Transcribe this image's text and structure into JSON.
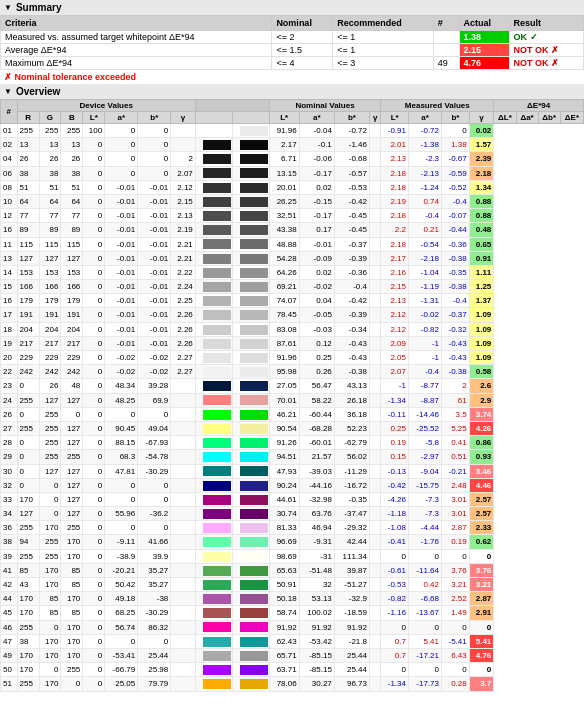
{
  "summary": {
    "title": "Summary",
    "columns": [
      "Criteria",
      "Nominal",
      "Recommended",
      "#",
      "Actual",
      "Result"
    ],
    "rows": [
      {
        "criteria": "Measured vs. assumed target whitepoint ΔE*94",
        "nominal": "<= 2",
        "recommended": "<= 1",
        "count": "",
        "actual": "1.38",
        "actual_color": "#00cc00",
        "result": "OK ✓",
        "result_class": "ok"
      },
      {
        "criteria": "Average ΔE*94",
        "nominal": "<= 1.5",
        "recommended": "<= 1",
        "count": "",
        "actual": "2.15",
        "actual_color": "#ff4444",
        "result": "NOT OK ✗",
        "result_class": "notok"
      },
      {
        "criteria": "Maximum ΔE*94",
        "nominal": "<= 4",
        "recommended": "<= 3",
        "count": "49",
        "actual": "4.76",
        "actual_color": "#ff0000",
        "result": "NOT OK ✗",
        "result_class": "notok"
      }
    ],
    "nominal_exceeded_label": "✗ Nominal tolerance exceeded"
  },
  "overview": {
    "title": "Overview",
    "col_headers": {
      "hash": "#",
      "device": "Device Values",
      "device_sub": [
        "#",
        "R",
        "G",
        "B",
        "L*",
        "a*",
        "b*",
        "γ"
      ],
      "nominal": "Nominal Values",
      "nominal_sub": [
        "L*",
        "a*",
        "b*",
        "γ"
      ],
      "measured": "Measured Values",
      "measured_sub": [
        "L*",
        "a*",
        "b*",
        "γ"
      ],
      "delta": "ΔE*94",
      "delta_sub": [
        "ΔL*",
        "Δa*",
        "Δb*",
        "ΔE*"
      ]
    },
    "rows": [
      {
        "n": "01",
        "r": 255,
        "g": 255,
        "b": 255,
        "L_nom": 100,
        "a_nom": 0,
        "b_nom": 0,
        "g_nom": null,
        "L_meas": 91.96,
        "a_meas": -0.04,
        "b_meas": -0.72,
        "g_meas": null,
        "dL": -0.91,
        "da": -0.72,
        "db": 0,
        "de": 0.02,
        "swatch": "#ffffff",
        "swatch_meas": "#e8e8e8"
      },
      {
        "n": "02",
        "r": 13,
        "g": 13,
        "b": 13,
        "L_nom": 0,
        "a_nom": 0,
        "b_nom": 0,
        "g_nom": null,
        "L_meas": 2.17,
        "a_meas": -0.1,
        "b_meas": -1.46,
        "g_meas": null,
        "dL": 2.01,
        "da": -1.38,
        "db": 1.38,
        "de": 1.57,
        "swatch": "#0d0d0d",
        "swatch_meas": "#080808"
      },
      {
        "n": "04",
        "r": 26,
        "g": 26,
        "b": 26,
        "L_nom": 0,
        "a_nom": 0,
        "b_nom": 0,
        "g_nom": 2,
        "L_meas": 6.71,
        "a_meas": -0.06,
        "b_meas": -0.68,
        "g_meas": null,
        "dL": 2.13,
        "da": -2.3,
        "db": -0.67,
        "de": 2.39,
        "swatch": "#1a1a1a",
        "swatch_meas": "#111111"
      },
      {
        "n": "06",
        "r": 38,
        "g": 38,
        "b": 38,
        "L_nom": 0,
        "a_nom": 0,
        "b_nom": 0,
        "g_nom": 2.07,
        "L_meas": 13.15,
        "a_meas": -0.17,
        "b_meas": -0.57,
        "g_meas": null,
        "dL": 2.18,
        "da": -2.13,
        "db": -0.59,
        "de": 2.18,
        "swatch": "#262626",
        "swatch_meas": "#1e1e1e"
      },
      {
        "n": "08",
        "r": 51,
        "g": 51,
        "b": 51,
        "L_nom": 0,
        "a_nom": -0.01,
        "b_nom": -0.01,
        "g_nom": 2.12,
        "L_meas": 20.01,
        "a_meas": 0.02,
        "b_meas": -0.53,
        "g_meas": null,
        "dL": 2.18,
        "da": -1.24,
        "db": -0.52,
        "de": 1.34,
        "swatch": "#333333",
        "swatch_meas": "#2e2e2e"
      },
      {
        "n": "10",
        "r": 64,
        "g": 64,
        "b": 64,
        "L_nom": 0,
        "a_nom": -0.01,
        "b_nom": -0.01,
        "g_nom": 2.15,
        "L_meas": 26.25,
        "a_meas": -0.15,
        "b_meas": -0.42,
        "g_meas": null,
        "dL": 2.19,
        "da": 0.74,
        "db": -0.4,
        "de": 0.88,
        "swatch": "#404040",
        "swatch_meas": "#3c3c3c"
      },
      {
        "n": "12",
        "r": 77,
        "g": 77,
        "b": 77,
        "L_nom": 0,
        "a_nom": -0.01,
        "b_nom": -0.01,
        "g_nom": 2.13,
        "L_meas": 32.51,
        "a_meas": -0.17,
        "b_meas": -0.45,
        "g_meas": null,
        "dL": 2.18,
        "da": -0.4,
        "db": -0.07,
        "de": 0.88,
        "swatch": "#4d4d4d",
        "swatch_meas": "#484848"
      },
      {
        "n": "16",
        "r": 89,
        "g": 89,
        "b": 89,
        "L_nom": 0,
        "a_nom": -0.01,
        "b_nom": -0.01,
        "g_nom": 2.19,
        "L_meas": 43.38,
        "a_meas": 0.17,
        "b_meas": -0.45,
        "g_meas": null,
        "dL": 2.2,
        "da": 0.21,
        "db": -0.44,
        "de": 0.48,
        "swatch": "#595959",
        "swatch_meas": "#555555"
      },
      {
        "n": "11",
        "r": 115,
        "g": 115,
        "b": 115,
        "L_nom": 0,
        "a_nom": -0.01,
        "b_nom": -0.01,
        "g_nom": 2.21,
        "L_meas": 48.88,
        "a_meas": -0.01,
        "b_meas": -0.37,
        "g_meas": null,
        "dL": 2.18,
        "da": -0.54,
        "db": -0.36,
        "de": 0.65,
        "swatch": "#737373",
        "swatch_meas": "#6e6e6e"
      },
      {
        "n": "13",
        "r": 127,
        "g": 127,
        "b": 127,
        "L_nom": 0,
        "a_nom": -0.01,
        "b_nom": -0.01,
        "g_nom": 2.21,
        "L_meas": 54.28,
        "a_meas": -0.09,
        "b_meas": -0.39,
        "g_meas": null,
        "dL": 2.17,
        "da": -2.18,
        "db": -0.38,
        "de": 0.91,
        "swatch": "#7f7f7f",
        "swatch_meas": "#7a7a7a"
      },
      {
        "n": "14",
        "r": 153,
        "g": 153,
        "b": 153,
        "L_nom": 0,
        "a_nom": -0.01,
        "b_nom": -0.01,
        "g_nom": 2.22,
        "L_meas": 64.26,
        "a_meas": 0.02,
        "b_meas": -0.36,
        "g_meas": null,
        "dL": 2.16,
        "da": -1.04,
        "db": -0.35,
        "de": 1.11,
        "swatch": "#999999",
        "swatch_meas": "#949494"
      },
      {
        "n": "15",
        "r": 166,
        "g": 166,
        "b": 166,
        "L_nom": 0,
        "a_nom": -0.01,
        "b_nom": -0.01,
        "g_nom": 2.24,
        "L_meas": 69.21,
        "a_meas": -0.02,
        "b_meas": -0.4,
        "g_meas": null,
        "dL": 2.15,
        "da": -1.19,
        "db": -0.38,
        "de": 1.25,
        "swatch": "#a6a6a6",
        "swatch_meas": "#a1a1a1"
      },
      {
        "n": "16",
        "r": 179,
        "g": 179,
        "b": 179,
        "L_nom": 0,
        "a_nom": -0.01,
        "b_nom": -0.01,
        "g_nom": 2.25,
        "L_meas": 74.07,
        "a_meas": 0.04,
        "b_meas": -0.42,
        "g_meas": null,
        "dL": 2.13,
        "da": -1.31,
        "db": -0.4,
        "de": 1.37,
        "swatch": "#b3b3b3",
        "swatch_meas": "#aeaeae"
      },
      {
        "n": "17",
        "r": 191,
        "g": 191,
        "b": 191,
        "L_nom": 0,
        "a_nom": -0.01,
        "b_nom": -0.01,
        "g_nom": 2.26,
        "L_meas": 78.45,
        "a_meas": -0.05,
        "b_meas": -0.39,
        "g_meas": null,
        "dL": 2.12,
        "da": -0.02,
        "db": -0.37,
        "de": 1.09,
        "swatch": "#bfbfbf",
        "swatch_meas": "#bababa"
      },
      {
        "n": "18",
        "r": 204,
        "g": 204,
        "b": 204,
        "L_nom": 0,
        "a_nom": -0.01,
        "b_nom": -0.01,
        "g_nom": 2.26,
        "L_meas": 83.08,
        "a_meas": -0.03,
        "b_meas": -0.34,
        "g_meas": null,
        "dL": 2.12,
        "da": -0.82,
        "db": -0.32,
        "de": 1.09,
        "swatch": "#cccccc",
        "swatch_meas": "#c7c7c7"
      },
      {
        "n": "19",
        "r": 217,
        "g": 217,
        "b": 217,
        "L_nom": 0,
        "a_nom": -0.01,
        "b_nom": -0.01,
        "g_nom": 2.26,
        "L_meas": 87.61,
        "a_meas": 0.12,
        "b_meas": -0.43,
        "g_meas": null,
        "dL": 2.09,
        "da": -1,
        "db": -0.43,
        "de": 1.09,
        "swatch": "#d9d9d9",
        "swatch_meas": "#d4d4d4"
      },
      {
        "n": "20",
        "r": 229,
        "g": 229,
        "b": 229,
        "L_nom": 0,
        "a_nom": -0.02,
        "b_nom": -0.02,
        "g_nom": 2.27,
        "L_meas": 91.96,
        "a_meas": 0.25,
        "b_meas": -0.43,
        "g_meas": null,
        "dL": 2.05,
        "da": -1,
        "db": -0.43,
        "de": 1.09,
        "swatch": "#e5e5e5",
        "swatch_meas": "#e0e0e0"
      },
      {
        "n": "22",
        "r": 242,
        "g": 242,
        "b": 242,
        "L_nom": 0,
        "a_nom": -0.02,
        "b_nom": -0.02,
        "g_nom": 2.27,
        "L_meas": 95.98,
        "a_meas": 0.26,
        "b_meas": -0.38,
        "g_meas": null,
        "dL": 2.07,
        "da": -0.4,
        "db": -0.38,
        "de": 0.58,
        "swatch": "#f2f2f2",
        "swatch_meas": "#ededed"
      },
      {
        "n": "23",
        "r": 0,
        "g": 26,
        "b": 48,
        "L_nom": 0,
        "a_nom": 48.34,
        "b_nom": 39.28,
        "g_nom": null,
        "L_meas": 27.05,
        "a_meas": 56.47,
        "b_meas": 43.13,
        "g_meas": null,
        "dL": -1,
        "da": -8.77,
        "db": 2,
        "de": 2.6,
        "swatch": "#001a30",
        "swatch_meas": "#0a1e3a"
      },
      {
        "n": "24",
        "r": 255,
        "g": 127,
        "b": 127,
        "L_nom": 0,
        "a_nom": 48.25,
        "b_nom": 69.9,
        "g_nom": null,
        "L_meas": 70.01,
        "a_meas": 58.22,
        "b_meas": 26.18,
        "g_meas": null,
        "dL": -1.34,
        "da": -8.87,
        "db": 61,
        "de": 2.9,
        "swatch": "#ff7f7f",
        "swatch_meas": "#e8a0a0"
      },
      {
        "n": "26",
        "r": 0,
        "g": 255,
        "b": 0,
        "L_nom": 0,
        "a_nom": 0,
        "b_nom": 0,
        "g_nom": null,
        "L_meas": 46.21,
        "a_meas": -60.44,
        "b_meas": 36.18,
        "g_meas": null,
        "dL": -0.11,
        "da": -14.46,
        "db": 3.5,
        "de": 3.74,
        "swatch": "#00ff00",
        "swatch_meas": "#00e800"
      },
      {
        "n": "27",
        "r": 255,
        "g": 255,
        "b": 127,
        "L_nom": 0,
        "a_nom": 90.45,
        "b_nom": 49.04,
        "g_nom": null,
        "L_meas": 90.54,
        "a_meas": -68.28,
        "b_meas": 52.23,
        "g_meas": null,
        "dL": 0.25,
        "da": -25.52,
        "db": 5.25,
        "de": 4.26,
        "swatch": "#ffff7f",
        "swatch_meas": "#faf0a0"
      },
      {
        "n": "28",
        "r": 0,
        "g": 255,
        "b": 127,
        "L_nom": 0,
        "a_nom": 88.15,
        "b_nom": -67.93,
        "g_nom": null,
        "L_meas": 91.26,
        "a_meas": -60.01,
        "b_meas": -62.79,
        "g_meas": null,
        "dL": 0.19,
        "da": -5.8,
        "db": 0.41,
        "de": 0.86,
        "swatch": "#00ff7f",
        "swatch_meas": "#00f07a"
      },
      {
        "n": "29",
        "r": 0,
        "g": 255,
        "b": 255,
        "L_nom": 0,
        "a_nom": 68.3,
        "b_nom": -54.78,
        "g_nom": null,
        "L_meas": 94.51,
        "a_meas": 21.57,
        "b_meas": 56.02,
        "g_meas": null,
        "dL": 0.15,
        "da": -2.97,
        "db": 0.51,
        "de": 0.93,
        "swatch": "#00ffff",
        "swatch_meas": "#00efef"
      },
      {
        "n": "30",
        "r": 0,
        "g": 127,
        "b": 127,
        "L_nom": 0,
        "a_nom": 47.81,
        "b_nom": -30.29,
        "g_nom": null,
        "L_meas": 47.93,
        "a_meas": -39.03,
        "b_meas": -11.29,
        "g_meas": null,
        "dL": -0.13,
        "da": -9.04,
        "db": -0.21,
        "de": 3.46,
        "swatch": "#007f7f",
        "swatch_meas": "#007070"
      },
      {
        "n": "32",
        "r": 0,
        "g": 0,
        "b": 127,
        "L_nom": 0,
        "a_nom": 0,
        "b_nom": 0,
        "g_nom": null,
        "L_meas": 90.24,
        "a_meas": -44.16,
        "b_meas": -16.72,
        "g_meas": null,
        "dL": -0.42,
        "da": -15.75,
        "db": 2.48,
        "de": 4.46,
        "swatch": "#00007f",
        "swatch_meas": "#1a1a8a"
      },
      {
        "n": "33",
        "r": 170,
        "g": 0,
        "b": 127,
        "L_nom": 0,
        "a_nom": 0,
        "b_nom": 0,
        "g_nom": null,
        "L_meas": 44.61,
        "a_meas": -32.98,
        "b_meas": -0.35,
        "g_meas": null,
        "dL": -4.26,
        "da": -7.3,
        "db": 3.01,
        "de": 2.57,
        "swatch": "#aa007f",
        "swatch_meas": "#9a1070"
      },
      {
        "n": "34",
        "r": 127,
        "g": 0,
        "b": 127,
        "L_nom": 0,
        "a_nom": 55.96,
        "b_nom": -36.2,
        "g_nom": null,
        "L_meas": 30.74,
        "a_meas": 63.76,
        "b_meas": -37.47,
        "g_meas": null,
        "dL": -1.18,
        "da": -7.3,
        "db": 3.01,
        "de": 2.57,
        "swatch": "#7f007f",
        "swatch_meas": "#6e0070"
      },
      {
        "n": "36",
        "r": 255,
        "g": 170,
        "b": 255,
        "L_nom": 0,
        "a_nom": 0,
        "b_nom": 0,
        "g_nom": null,
        "L_meas": 81.33,
        "a_meas": 46.94,
        "b_meas": -29.32,
        "g_meas": null,
        "dL": -1.08,
        "da": -4.44,
        "db": 2.87,
        "de": 2.33,
        "swatch": "#ffaaff",
        "swatch_meas": "#f0c0f0"
      },
      {
        "n": "38",
        "r": 94,
        "g": 255,
        "b": 170,
        "L_nom": 0,
        "a_nom": -9.11,
        "b_nom": 41.66,
        "g_nom": null,
        "L_meas": 96.69,
        "a_meas": -9.31,
        "b_meas": 42.44,
        "g_meas": null,
        "dL": -0.41,
        "da": -1.76,
        "db": 0.19,
        "de": 0.62,
        "swatch": "#5effaa",
        "swatch_meas": "#70f0b0"
      },
      {
        "n": "39",
        "r": 255,
        "g": 255,
        "b": 170,
        "L_nom": 0,
        "a_nom": -38.9,
        "b_nom": 39.9,
        "g_nom": null,
        "L_meas": 98.69,
        "a_meas": -31,
        "b_meas": 111.34,
        "g_meas": null,
        "dL": 0,
        "da": 0,
        "db": 0,
        "de": 0,
        "swatch": "#ffffaa",
        "swatch_meas": "#fffff0"
      },
      {
        "n": "41",
        "r": 85,
        "g": 170,
        "b": 85,
        "L_nom": 0,
        "a_nom": -20.21,
        "b_nom": 35.27,
        "g_nom": null,
        "L_meas": 65.63,
        "a_meas": -51.48,
        "b_meas": 39.87,
        "g_meas": null,
        "dL": -0.61,
        "da": -11.64,
        "db": 3.76,
        "de": 3.76,
        "swatch": "#55aa55",
        "swatch_meas": "#48a048"
      },
      {
        "n": "42",
        "r": 43,
        "g": 170,
        "b": 85,
        "L_nom": 0,
        "a_nom": 50.42,
        "b_nom": 35.27,
        "g_nom": null,
        "L_meas": 50.91,
        "a_meas": 32,
        "b_meas": -51.27,
        "g_meas": null,
        "dL": -0.53,
        "da": 0.42,
        "db": 3.21,
        "de": 3.21,
        "swatch": "#2baa55",
        "swatch_meas": "#209050"
      },
      {
        "n": "44",
        "r": 170,
        "g": 85,
        "b": 170,
        "L_nom": 0,
        "a_nom": 49.18,
        "b_nom": -38,
        "g_nom": null,
        "L_meas": 50.18,
        "a_meas": 53.13,
        "b_meas": -32.9,
        "g_meas": null,
        "dL": -0.82,
        "da": -6.68,
        "db": 2.52,
        "de": 2.87,
        "swatch": "#aa55aa",
        "swatch_meas": "#9850a0"
      },
      {
        "n": "45",
        "r": 170,
        "g": 85,
        "b": 85,
        "L_nom": 0,
        "a_nom": 68.25,
        "b_nom": -30.29,
        "g_nom": null,
        "L_meas": 58.74,
        "a_meas": 100.02,
        "b_meas": -18.59,
        "g_meas": null,
        "dL": -1.16,
        "da": -13.67,
        "db": 1.49,
        "de": 2.91,
        "swatch": "#aa5555",
        "swatch_meas": "#9a4848"
      },
      {
        "n": "46",
        "r": 255,
        "g": 0,
        "b": 170,
        "L_nom": 0,
        "a_nom": 56.74,
        "b_nom": 86.32,
        "g_nom": null,
        "L_meas": 91.92,
        "a_meas": 91.92,
        "b_meas": 91.92,
        "g_meas": null,
        "dL": 0,
        "da": 0,
        "db": 0,
        "de": 0,
        "swatch": "#ff00aa",
        "swatch_meas": "#f000c0"
      },
      {
        "n": "47",
        "r": 38,
        "g": 170,
        "b": 170,
        "L_nom": 0,
        "a_nom": 0,
        "b_nom": 0,
        "g_nom": null,
        "L_meas": 62.43,
        "a_meas": -53.42,
        "b_meas": -21.8,
        "g_meas": null,
        "dL": 0.7,
        "da": 5.41,
        "db": -5.41,
        "de": 5.41,
        "swatch": "#26aaaa",
        "swatch_meas": "#1898a0"
      },
      {
        "n": "49",
        "r": 170,
        "g": 170,
        "b": 170,
        "L_nom": 0,
        "a_nom": -53.41,
        "b_nom": 25.44,
        "g_nom": null,
        "L_meas": 65.71,
        "a_meas": -85.15,
        "b_meas": 25.44,
        "g_meas": null,
        "dL": 0.7,
        "da": -17.21,
        "db": 6.43,
        "de": 4.76,
        "swatch": "#aaaaaa",
        "swatch_meas": "#9c9c9c"
      },
      {
        "n": "50",
        "r": 170,
        "g": 0,
        "b": 255,
        "L_nom": 0,
        "a_nom": -66.79,
        "b_nom": 25.98,
        "g_nom": null,
        "L_meas": 63.71,
        "a_meas": -85.15,
        "b_meas": 25.44,
        "g_meas": null,
        "dL": 0,
        "da": 0,
        "db": 0,
        "de": 0,
        "swatch": "#aa00ff",
        "swatch_meas": "#8000f0"
      },
      {
        "n": "51",
        "r": 255,
        "g": 170,
        "b": 0,
        "L_nom": 0,
        "a_nom": 25.05,
        "b_nom": 79.79,
        "g_nom": null,
        "L_meas": 78.06,
        "a_meas": 30.27,
        "b_meas": 96.73,
        "g_meas": null,
        "dL": -1.34,
        "da": -17.73,
        "db": 0.28,
        "de": 3.7,
        "swatch": "#ffaa00",
        "swatch_meas": "#f0b000"
      }
    ]
  }
}
